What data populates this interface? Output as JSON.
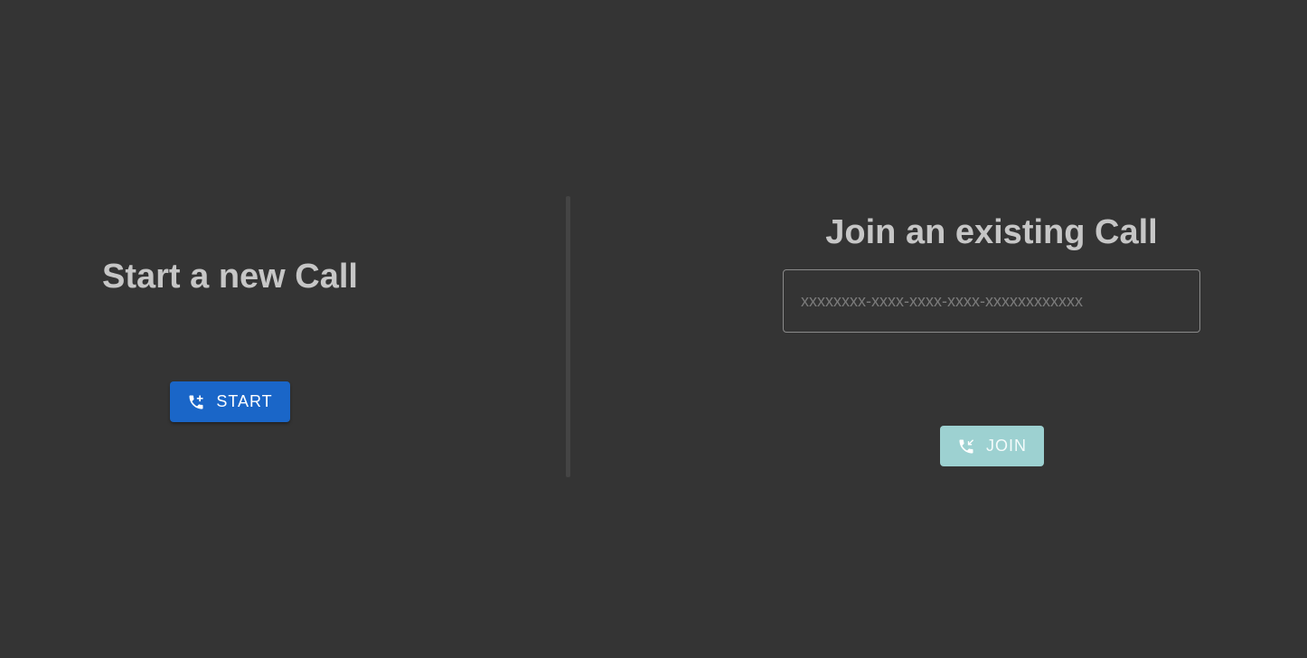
{
  "start_section": {
    "title": "Start a new Call",
    "button_label": "START",
    "button_icon": "add-call-icon",
    "button_color": "#1a66c8"
  },
  "join_section": {
    "title": "Join an existing Call",
    "call_id_input": {
      "value": "",
      "placeholder": "xxxxxxxx-xxxx-xxxx-xxxx-xxxxxxxxxxxx"
    },
    "button_label": "JOIN",
    "button_icon": "call-received-icon",
    "button_color": "#9dd1d1"
  },
  "colors": {
    "background": "#343434",
    "title_text": "#c6c6c6",
    "divider": "#444444"
  }
}
